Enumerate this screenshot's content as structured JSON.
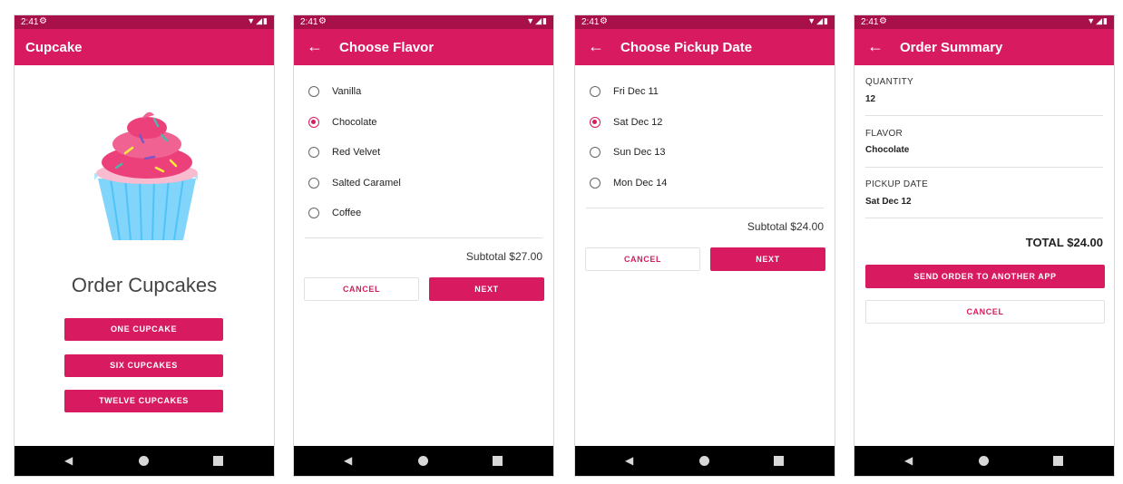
{
  "status": {
    "time": "2:41"
  },
  "screen1": {
    "title": "Cupcake",
    "heading": "Order Cupcakes",
    "buttons": [
      "ONE CUPCAKE",
      "SIX CUPCAKES",
      "TWELVE CUPCAKES"
    ]
  },
  "screen2": {
    "title": "Choose Flavor",
    "options": [
      "Vanilla",
      "Chocolate",
      "Red Velvet",
      "Salted Caramel",
      "Coffee"
    ],
    "selected": "Chocolate",
    "subtotal": "Subtotal $27.00",
    "cancel": "CANCEL",
    "next": "NEXT"
  },
  "screen3": {
    "title": "Choose Pickup Date",
    "options": [
      "Fri Dec 11",
      "Sat Dec 12",
      "Sun Dec 13",
      "Mon Dec 14"
    ],
    "selected": "Sat Dec 12",
    "subtotal": "Subtotal $24.00",
    "cancel": "CANCEL",
    "next": "NEXT"
  },
  "screen4": {
    "title": "Order Summary",
    "quantity_label": "QUANTITY",
    "quantity_value": "12",
    "flavor_label": "FLAVOR",
    "flavor_value": "Chocolate",
    "pickup_label": "PICKUP DATE",
    "pickup_value": "Sat Dec 12",
    "total": "TOTAL $24.00",
    "send": "SEND ORDER TO ANOTHER APP",
    "cancel": "CANCEL"
  },
  "colors": {
    "primary": "#d81b60",
    "primary_dark": "#a8104a"
  },
  "icons": [
    "settings-icon",
    "wifi-icon",
    "signal-icon",
    "battery-icon",
    "back-arrow-icon",
    "nav-back-icon",
    "nav-home-icon",
    "nav-recents-icon",
    "cupcake-illustration"
  ]
}
